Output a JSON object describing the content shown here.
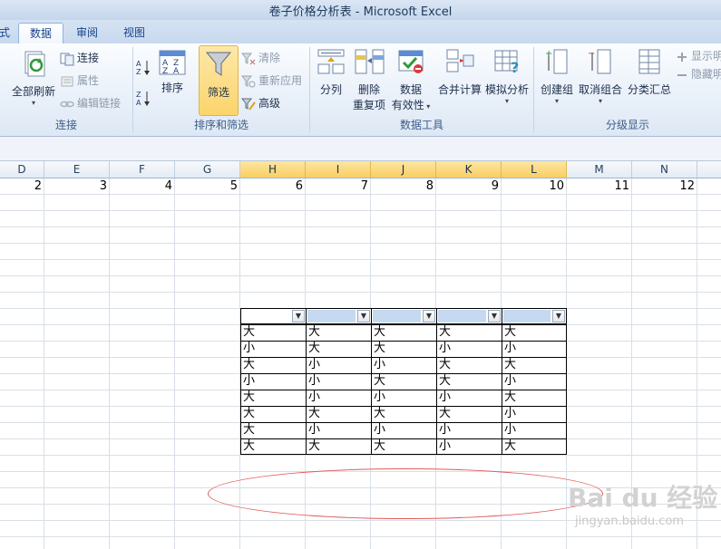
{
  "window": {
    "title": "卷子价格分析表 - Microsoft Excel"
  },
  "tabs": {
    "partial": "式",
    "data": "数据",
    "review": "审阅",
    "view": "视图"
  },
  "ribbon": {
    "connections": {
      "refresh_all": "全部刷新",
      "connections": "连接",
      "properties": "属性",
      "edit_links": "编辑链接",
      "group_label": "连接"
    },
    "sort_filter": {
      "sort": "排序",
      "filter": "筛选",
      "clear": "清除",
      "reapply": "重新应用",
      "advanced": "高级",
      "group_label": "排序和筛选"
    },
    "data_tools": {
      "text_to_columns": "分列",
      "remove_dup_1": "删除",
      "remove_dup_2": "重复项",
      "validation_1": "数据",
      "validation_2": "有效性",
      "consolidate": "合并计算",
      "what_if": "模拟分析",
      "group_label": "数据工具"
    },
    "outline": {
      "group": "创建组",
      "ungroup": "取消组合",
      "subtotal": "分类汇总",
      "show_detail": "显示明",
      "hide_detail": "隐藏明",
      "group_label": "分级显示"
    }
  },
  "columns": [
    "D",
    "E",
    "F",
    "G",
    "H",
    "I",
    "J",
    "K",
    "L",
    "M",
    "N"
  ],
  "selected_columns": [
    "H",
    "I",
    "J",
    "K",
    "L"
  ],
  "row1_values": [
    "2",
    "3",
    "4",
    "5",
    "6",
    "7",
    "8",
    "9",
    "10",
    "11",
    "12"
  ],
  "table": {
    "rows": [
      [
        "大",
        "大",
        "大",
        "大",
        "大"
      ],
      [
        "小",
        "大",
        "大",
        "小",
        "小"
      ],
      [
        "大",
        "小",
        "小",
        "大",
        "大"
      ],
      [
        "小",
        "小",
        "大",
        "大",
        "小"
      ],
      [
        "大",
        "小",
        "小",
        "小",
        "大"
      ],
      [
        "大",
        "大",
        "大",
        "大",
        "小"
      ],
      [
        "大",
        "小",
        "小",
        "小",
        "小"
      ],
      [
        "大",
        "大",
        "大",
        "小",
        "大"
      ]
    ]
  },
  "watermark": {
    "main": "Bai du 经验",
    "sub": "jingyan.baidu.com"
  },
  "colors": {
    "accent": "#fbd46b",
    "header_fill": "#c5d9f1",
    "ellipse": "#e05a5a"
  }
}
